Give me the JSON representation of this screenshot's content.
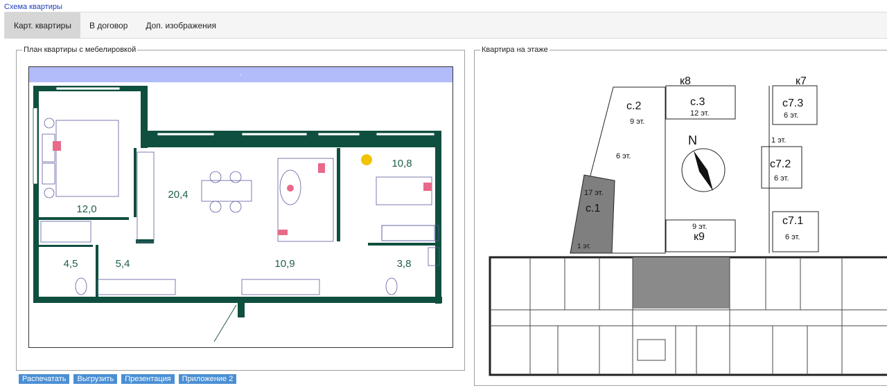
{
  "header": {
    "link": "Схема квартиры"
  },
  "tabs": [
    {
      "label": "Карт. квартиры",
      "active": true
    },
    {
      "label": "В договор",
      "active": false
    },
    {
      "label": "Доп. изображения",
      "active": false
    }
  ],
  "plan": {
    "legend": "План квартиры с мебелировкой",
    "banner": "-",
    "rooms": {
      "bedroom_left": "12,0",
      "living": "20,4",
      "bedroom_right": "10,8",
      "bath": "4,5",
      "hall": "5,4",
      "corridor": "10,9",
      "wc": "3,8"
    }
  },
  "floor": {
    "legend": "Квартира на этаже",
    "sections": {
      "k8": "к8",
      "k7": "к7",
      "c2": "с.2",
      "c2_floors": "9 эт.",
      "c2_lower": "6 эт.",
      "c3": "с.3",
      "c3_floors": "12 эт.",
      "c73": "с7.3",
      "c73_floors": "6 эт.",
      "one_floor": "1 эт.",
      "c72": "с7.2",
      "c72_floors": "6 эт.",
      "c1": "с.1",
      "c1_floors": "17 эт.",
      "c1_low": "1 эт.",
      "k9": "к9",
      "k9_floors": "9 эт.",
      "c71": "с7.1",
      "c71_floors": "6 эт."
    },
    "compass": "N"
  },
  "buttons": [
    "Распечатать",
    "Выгрузить",
    "Презентация",
    "Приложение 2"
  ],
  "colors": {
    "wall": "#0f4f3f",
    "banner": "#b3bcfa",
    "accent_text": "#1f5e48",
    "button": "#4a8fd4",
    "highlight": "#7f7f7f"
  }
}
